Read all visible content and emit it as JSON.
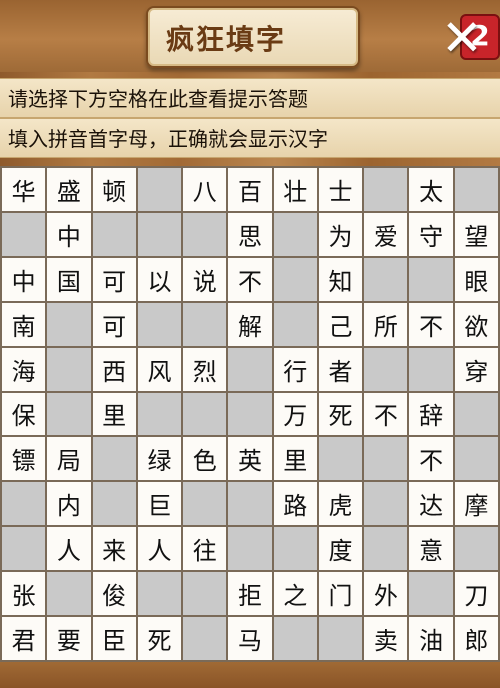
{
  "header": {
    "title": "疯狂填字",
    "level": "2",
    "close_icon": "close-icon"
  },
  "hints": {
    "line1": "请选择下方空格在此查看提示答题",
    "line2": "填入拼音首字母，正确就会显示汉字"
  },
  "grid": {
    "rows": [
      [
        "华",
        "盛",
        "顿",
        "",
        "八",
        "百",
        "壮",
        "士",
        "",
        "太",
        ""
      ],
      [
        "",
        "中",
        "",
        "",
        "",
        "思",
        "",
        "为",
        "爱",
        "守",
        "望"
      ],
      [
        "中",
        "国",
        "可",
        "以",
        "说",
        "不",
        "",
        "知",
        "",
        "",
        "眼"
      ],
      [
        "南",
        "",
        "可",
        "",
        "",
        "解",
        "",
        "己",
        "所",
        "不",
        "欲"
      ],
      [
        "海",
        "",
        "西",
        "风",
        "烈",
        "",
        "行",
        "者",
        "",
        "",
        "穿"
      ],
      [
        "保",
        "",
        "里",
        "",
        "",
        "",
        "万",
        "死",
        "不",
        "辞",
        ""
      ],
      [
        "镖",
        "局",
        "",
        "绿",
        "色",
        "英",
        "里",
        "",
        "",
        "不",
        ""
      ],
      [
        "",
        "内",
        "",
        "巨",
        "",
        "",
        "路",
        "虎",
        "",
        "达",
        "摩"
      ],
      [
        "",
        "人",
        "来",
        "人",
        "往",
        "",
        "",
        "度",
        "",
        "意",
        ""
      ],
      [
        "张",
        "",
        "俊",
        "",
        "",
        "拒",
        "之",
        "门",
        "外",
        "",
        "刀"
      ],
      [
        "君",
        "要",
        "臣",
        "死",
        "",
        "马",
        "",
        "",
        "卖",
        "油",
        "郎"
      ]
    ]
  }
}
